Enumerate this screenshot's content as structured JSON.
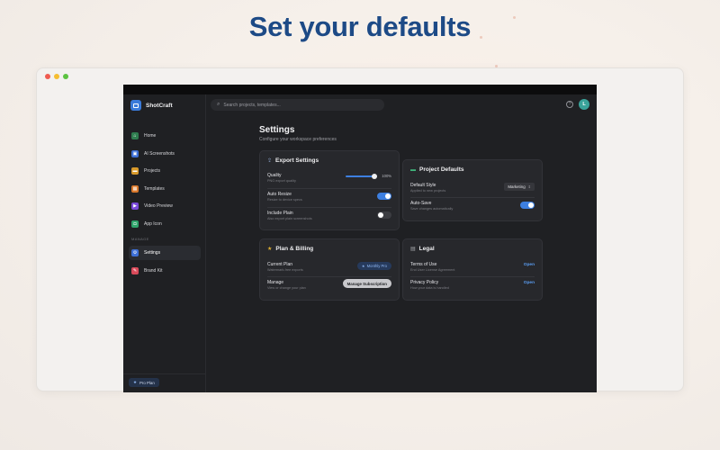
{
  "headline": "Set your defaults",
  "app": {
    "brand": "ShotCraft",
    "search_placeholder": "Search projects, templates...",
    "help_icon": "question-circle-icon",
    "avatar_initial": "L"
  },
  "sidebar": {
    "items": [
      {
        "label": "Home",
        "icon": "home-icon",
        "color": "#2f7d4f"
      },
      {
        "label": "AI Screenshots",
        "icon": "image-icon",
        "color": "#3d6fd6"
      },
      {
        "label": "Projects",
        "icon": "folder-icon",
        "color": "#d99a2b"
      },
      {
        "label": "Templates",
        "icon": "grid-icon",
        "color": "#d9782b"
      },
      {
        "label": "Video Preview",
        "icon": "video-icon",
        "color": "#7a4ad9"
      },
      {
        "label": "App Icon",
        "icon": "app-icon",
        "color": "#2fa36b"
      }
    ],
    "section_label": "MANAGE",
    "manage_items": [
      {
        "label": "Settings",
        "icon": "gear-icon",
        "color": "#3d6fd6",
        "active": true
      },
      {
        "label": "Brand Kit",
        "icon": "brush-icon",
        "color": "#d94a5a"
      }
    ],
    "plan_label": "Pro Plan"
  },
  "page": {
    "title": "Settings",
    "subtitle": "Configure your workspace preferences"
  },
  "export": {
    "title": "Export Settings",
    "quality": {
      "label": "Quality",
      "desc": "PNG export quality",
      "value": "100%",
      "level": 1.0
    },
    "auto_resize": {
      "label": "Auto Resize",
      "desc": "Resize to device specs",
      "on": true
    },
    "include_plain": {
      "label": "Include Plain",
      "desc": "Also export plain screenshots",
      "on": false
    }
  },
  "defaults": {
    "title": "Project Defaults",
    "style": {
      "label": "Default Style",
      "desc": "Applied to new projects",
      "value": "Marketing"
    },
    "autosave": {
      "label": "Auto-Save",
      "desc": "Save changes automatically",
      "on": true
    }
  },
  "billing": {
    "title": "Plan & Billing",
    "current": {
      "label": "Current Plan",
      "desc": "Watermark-free exports",
      "badge": "Monthly Pro"
    },
    "manage": {
      "label": "Manage",
      "desc": "View or change your plan",
      "button": "Manage Subscription"
    }
  },
  "legal": {
    "title": "Legal",
    "terms": {
      "label": "Terms of Use",
      "desc": "End User License Agreement",
      "link": "Open"
    },
    "privacy": {
      "label": "Privacy Policy",
      "desc": "How your data is handled",
      "link": "Open"
    }
  },
  "colors": {
    "accent": "#3d7fe0",
    "headline": "#1d4a86"
  }
}
